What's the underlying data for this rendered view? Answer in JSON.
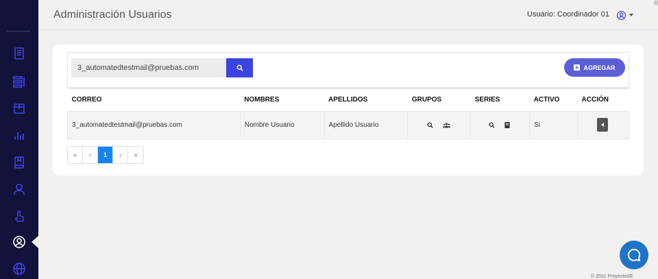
{
  "header": {
    "title": "Administración Usuarios",
    "user_label": "Usuario: Coordinador 01"
  },
  "sidebar": {
    "items": [
      {
        "icon": "document-icon"
      },
      {
        "icon": "list-icon"
      },
      {
        "icon": "box-icon"
      },
      {
        "icon": "bar-chart-icon"
      },
      {
        "icon": "book-icon"
      },
      {
        "icon": "user-icon"
      },
      {
        "icon": "hand-pointer-icon"
      },
      {
        "icon": "user-circle-icon",
        "active": true
      },
      {
        "icon": "globe-icon"
      }
    ]
  },
  "search": {
    "value": "3_automatedtestmail@pruebas.com"
  },
  "toolbar": {
    "add_label": "AGREGAR"
  },
  "table": {
    "columns": [
      "CORREO",
      "NOMBRES",
      "APELLIDOS",
      "GRUPOS",
      "SERIES",
      "ACTIVO",
      "ACCIÓN"
    ],
    "rows": [
      {
        "correo": "3_automatedtestmail@pruebas.com",
        "nombres": "Nombre Usuario",
        "apellidos": "Apellido Usuario",
        "activo": "Si"
      }
    ]
  },
  "pagination": {
    "first": "«",
    "prev": "‹",
    "current": "1",
    "next": "›",
    "last": "»"
  },
  "footer": {
    "text": "© 2021 ProyectoSE"
  },
  "colors": {
    "sidebar_bg": "#13123a",
    "sidebar_icon": "#3b45e6",
    "primary": "#3a44e0",
    "add_button": "#5b5fd6",
    "page_active": "#1684f0",
    "chat": "#1f73c9"
  }
}
